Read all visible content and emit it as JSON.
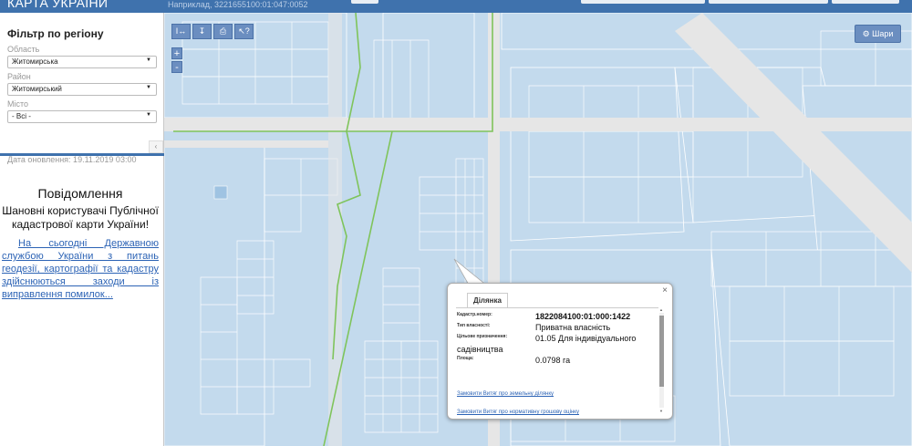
{
  "header": {
    "brand": "КАРТА УКРАЇНИ",
    "hint": "Наприклад, 3221655100:01:047:0052"
  },
  "filter": {
    "title": "Фільтр по регіону",
    "region_label": "Область",
    "region_value": "Житомирська",
    "district_label": "Район",
    "district_value": "Житомирський",
    "city_label": "Місто",
    "city_value": "- Всі -"
  },
  "collapse_icon": "‹",
  "updated": "Дата оновлення: 19.11.2019 03:00",
  "notice": {
    "title": "Повідомлення",
    "greeting": "Шановні користувачі Публічної кадастрової карти України!",
    "body": "На сьогодні Державною службою України з питань геодезії, картографії та кадастру здійснюються заходи із виправлення помилок..."
  },
  "map": {
    "tools": [
      "I↔",
      "↧",
      "⎙",
      "↖?"
    ],
    "zoom_in": "+",
    "zoom_out": "-",
    "layers_button": "⚙ Шари"
  },
  "popup": {
    "tab": "Ділянка",
    "close": "×",
    "rows": [
      {
        "key": "Кадастр.номер:",
        "value": "1822084100:01:000:1422"
      },
      {
        "key": "Тип власності:",
        "value": "Приватна власність"
      },
      {
        "key": "Цільове призначення:",
        "value": "01.05 Для індивідуального"
      },
      {
        "key": "",
        "value": "садівництва"
      },
      {
        "key": "Площа:",
        "value": "0.0798 га"
      }
    ],
    "link1": "Замовити Витяг про земельну ділянку",
    "link2": "Замовити Витяг про нормативну грошову оцінку"
  },
  "colors": {
    "header": "#3f72ad",
    "map_bg": "#c3daed",
    "roads": "#e6e6e6",
    "boundary": "#7fc45b"
  }
}
